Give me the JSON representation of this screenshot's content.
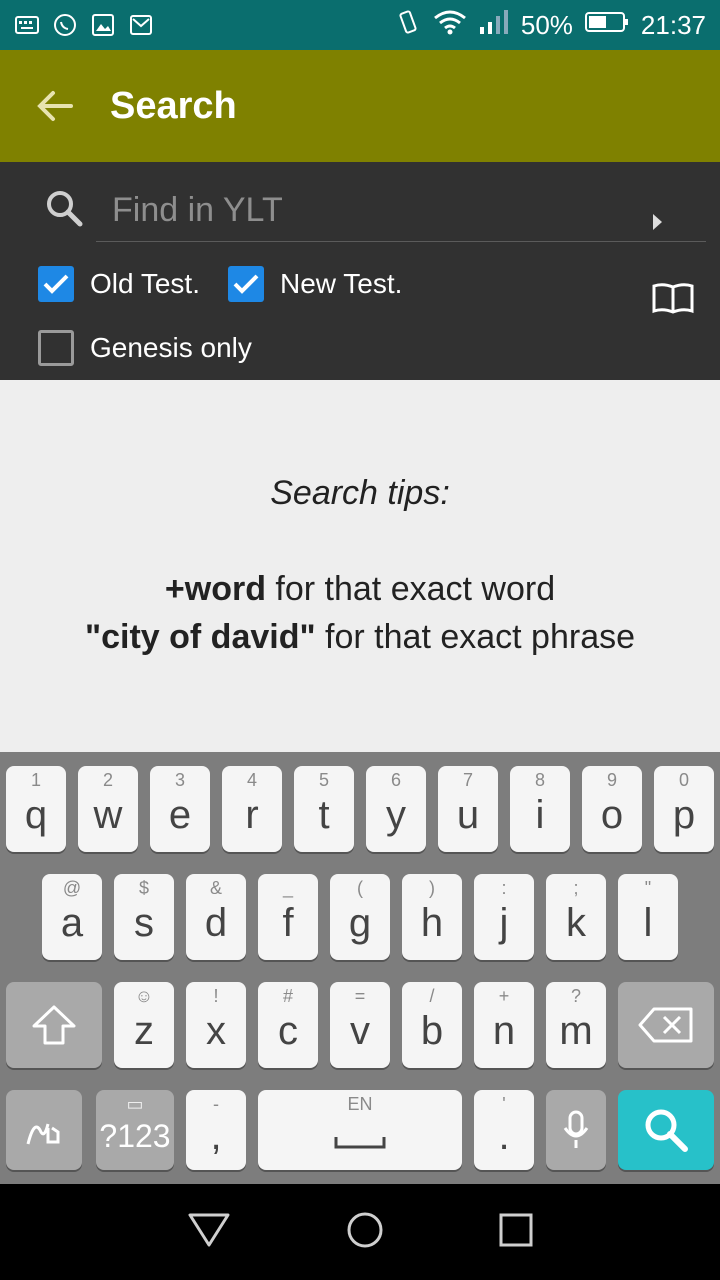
{
  "status_bar": {
    "icons_left": [
      "keyboard-icon",
      "whatsapp-icon",
      "gallery-icon",
      "gmail-icon"
    ],
    "battery": "50%",
    "time": "21:37"
  },
  "appbar": {
    "title": "Search",
    "color": "#7f8100"
  },
  "search": {
    "placeholder": "Find in YLT",
    "checkboxes": [
      {
        "label": "Old Test.",
        "checked": true
      },
      {
        "label": "New Test.",
        "checked": true
      },
      {
        "label": "Genesis only",
        "checked": false
      }
    ]
  },
  "tips": {
    "title": "Search tips:",
    "tip1_bold": "+word",
    "tip1_rest": " for that exact word",
    "tip2_bold": "\"city of david\"",
    "tip2_rest": " for that exact phrase"
  },
  "keyboard": {
    "row1": [
      {
        "k": "q",
        "h": "1"
      },
      {
        "k": "w",
        "h": "2"
      },
      {
        "k": "e",
        "h": "3"
      },
      {
        "k": "r",
        "h": "4"
      },
      {
        "k": "t",
        "h": "5"
      },
      {
        "k": "y",
        "h": "6"
      },
      {
        "k": "u",
        "h": "7"
      },
      {
        "k": "i",
        "h": "8"
      },
      {
        "k": "o",
        "h": "9"
      },
      {
        "k": "p",
        "h": "0"
      }
    ],
    "row2": [
      {
        "k": "a",
        "h": "@"
      },
      {
        "k": "s",
        "h": "$"
      },
      {
        "k": "d",
        "h": "&"
      },
      {
        "k": "f",
        "h": "_"
      },
      {
        "k": "g",
        "h": "("
      },
      {
        "k": "h",
        "h": ")"
      },
      {
        "k": "j",
        "h": ":"
      },
      {
        "k": "k",
        "h": ";"
      },
      {
        "k": "l",
        "h": "\""
      }
    ],
    "row3": [
      {
        "k": "z",
        "h": "☺"
      },
      {
        "k": "x",
        "h": "!"
      },
      {
        "k": "c",
        "h": "#"
      },
      {
        "k": "v",
        "h": "="
      },
      {
        "k": "b",
        "h": "/"
      },
      {
        "k": "n",
        "h": "+"
      },
      {
        "k": "m",
        "h": "?"
      }
    ],
    "symbols_label": "?123",
    "comma": ",",
    "comma_hint": "-",
    "space_hint": "EN",
    "period": ".",
    "period_hint": "'"
  }
}
